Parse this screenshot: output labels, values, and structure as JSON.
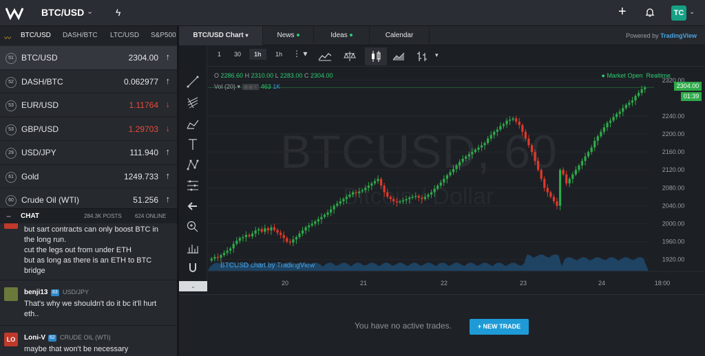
{
  "header": {
    "pair": "BTC/USD",
    "avatar_initials": "TC",
    "accent": "#16a085"
  },
  "markets": {
    "tabs": [
      "BTC/USD",
      "DASH/BTC",
      "LTC/USD",
      "S&P500"
    ],
    "rows": [
      {
        "badge": "51",
        "name": "BTC/USD",
        "price": "2304.00",
        "dir": "up"
      },
      {
        "badge": "52",
        "name": "DASH/BTC",
        "price": "0.062977",
        "dir": "up"
      },
      {
        "badge": "53",
        "name": "EUR/USD",
        "price": "1.11764",
        "dir": "down"
      },
      {
        "badge": "53",
        "name": "GBP/USD",
        "price": "1.29703",
        "dir": "down"
      },
      {
        "badge": "29",
        "name": "USD/JPY",
        "price": "111.940",
        "dir": "up"
      },
      {
        "badge": "61",
        "name": "Gold",
        "price": "1249.733",
        "dir": "up"
      },
      {
        "badge": "60",
        "name": "Crude Oil (WTI)",
        "price": "51.256",
        "dir": "up"
      }
    ]
  },
  "chat": {
    "title": "CHAT",
    "posts": "284.3K POSTS",
    "online": "624 ONLINE",
    "messages": [
      {
        "lines": [
          "but sart contracts can only boost BTC in",
          "the long run.",
          "cut the legs out from under ETH",
          "but as long as there is an ETH to BTC",
          "bridge"
        ]
      },
      {
        "user": "benji13",
        "level": "83",
        "pair": "USD/JPY",
        "lines": [
          "That's why we shouldn't do it bc it'll hurt",
          "eth.."
        ]
      },
      {
        "user": "Loni-V",
        "level": "62",
        "pair": "CRUDE OIL (WTI)",
        "avatar_text": "LO",
        "lines": [
          "maybe that won't be necessary"
        ]
      }
    ]
  },
  "chart_tabs": {
    "tabs": [
      "BTC/USD Chart",
      "News",
      "Ideas",
      "Calendar"
    ],
    "powered_prefix": "Powered by",
    "powered_brand": "TradingView"
  },
  "toolbar": {
    "intervals": [
      "1",
      "30",
      "1h",
      "1h"
    ]
  },
  "chart_info": {
    "open_label": "O",
    "open": "2286.60",
    "high_label": "H",
    "high": "2310.00",
    "low_label": "L",
    "low": "2283.00",
    "close_label": "C",
    "close": "2304.00",
    "vol_label": "Vol (20)",
    "vol_value": "463",
    "vol_ma": "1K",
    "market_status": "Market Open",
    "realtime": "Realtime",
    "watermark_symbol": "BTCUSD, 60",
    "watermark_desc": "Bitcoin / Dollar",
    "credit": "BTCUSD chart by TradingView",
    "price_tag": "2304.00",
    "time_tag": "01:39"
  },
  "chart_data": {
    "type": "candlestick",
    "title": "BTCUSD, 60",
    "subtitle": "Bitcoin / Dollar",
    "x_tick_labels": [
      "20",
      "21",
      "22",
      "23",
      "24",
      "18:00"
    ],
    "y_tick_labels": [
      "1920.00",
      "1960.00",
      "2000.00",
      "2040.00",
      "2080.00",
      "2120.00",
      "2160.00",
      "2200.00",
      "2240.00",
      "2320.00"
    ],
    "ylim": [
      1895,
      2335
    ],
    "close_series": [
      1922,
      1926,
      1924,
      1930,
      1935,
      1940,
      1945,
      1955,
      1962,
      1968,
      1970,
      1975,
      1972,
      1978,
      1985,
      1988,
      1982,
      1990,
      1985,
      1992,
      1986,
      1980,
      1975,
      1968,
      1960,
      1958,
      1965,
      1970,
      1978,
      1985,
      1992,
      1996,
      2000,
      2005,
      2010,
      2015,
      2020,
      2025,
      2032,
      2040,
      2045,
      2050,
      2055,
      2060,
      2065,
      2070,
      2068,
      2072,
      2075,
      2080,
      2085,
      2090,
      2095,
      2100,
      2085,
      2070,
      2060,
      2055,
      2050,
      2048,
      2050,
      2052,
      2055,
      2058,
      2060,
      2062,
      2058,
      2055,
      2060,
      2065,
      2070,
      2078,
      2085,
      2092,
      2100,
      2108,
      2115,
      2122,
      2130,
      2138,
      2145,
      2150,
      2155,
      2160,
      2165,
      2170,
      2175,
      2180,
      2190,
      2198,
      2205,
      2210,
      2218,
      2222,
      2230,
      2232,
      2235,
      2228,
      2220,
      2205,
      2190,
      2175,
      2160,
      2140,
      2120,
      2100,
      2080,
      2070,
      2060,
      2050,
      2040,
      2120,
      2110,
      2090,
      2100,
      2110,
      2120,
      2130,
      2140,
      2150,
      2160,
      2170,
      2185,
      2195,
      2205,
      2215,
      2225,
      2230,
      2238,
      2245,
      2250,
      2258,
      2265,
      2270,
      2275,
      2285,
      2292,
      2300,
      2304
    ],
    "current_price": 2304.0
  },
  "bottom": {
    "empty_text": "You have no active trades.",
    "new_trade": "+ NEW TRADE"
  }
}
